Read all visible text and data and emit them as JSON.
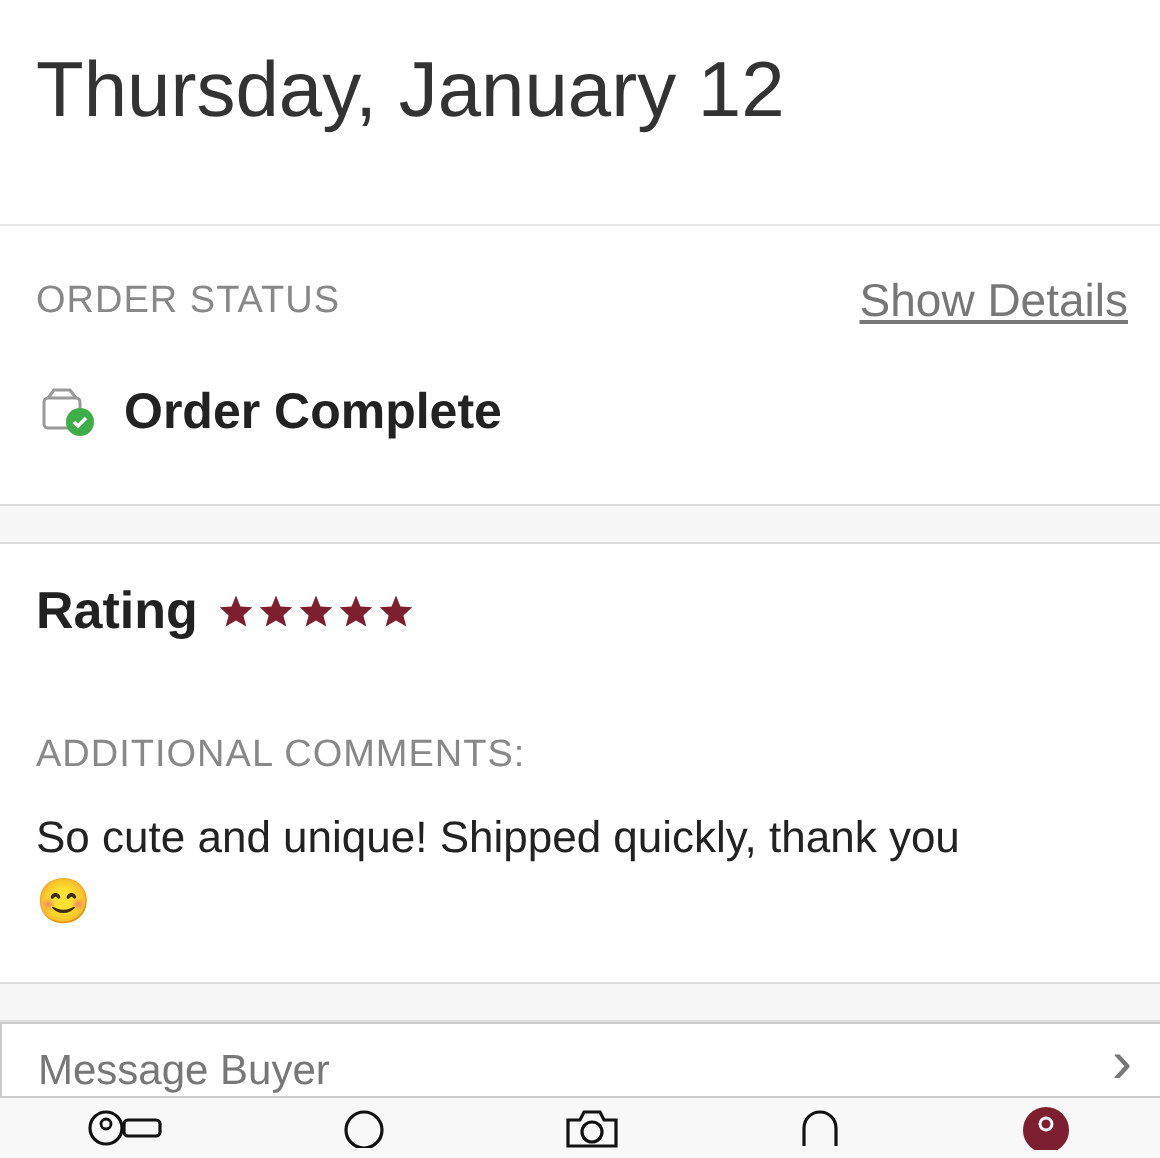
{
  "date_heading": "Thursday, January 12",
  "order_status": {
    "label": "ORDER STATUS",
    "details_link": "Show Details",
    "status": "Order Complete"
  },
  "rating": {
    "label": "Rating",
    "stars": 5
  },
  "comments": {
    "label": "ADDITIONAL COMMENTS:",
    "text": "So cute and unique! Shipped quickly, thank you",
    "emoji": "😊"
  },
  "message_row": {
    "label": "Message Buyer",
    "chevron": "›"
  },
  "tab_bar": [
    {
      "kind": "listings",
      "selected": false
    },
    {
      "kind": "circle",
      "selected": false
    },
    {
      "kind": "camera",
      "selected": false
    },
    {
      "kind": "bag",
      "selected": false
    },
    {
      "kind": "profile",
      "selected": true
    }
  ]
}
